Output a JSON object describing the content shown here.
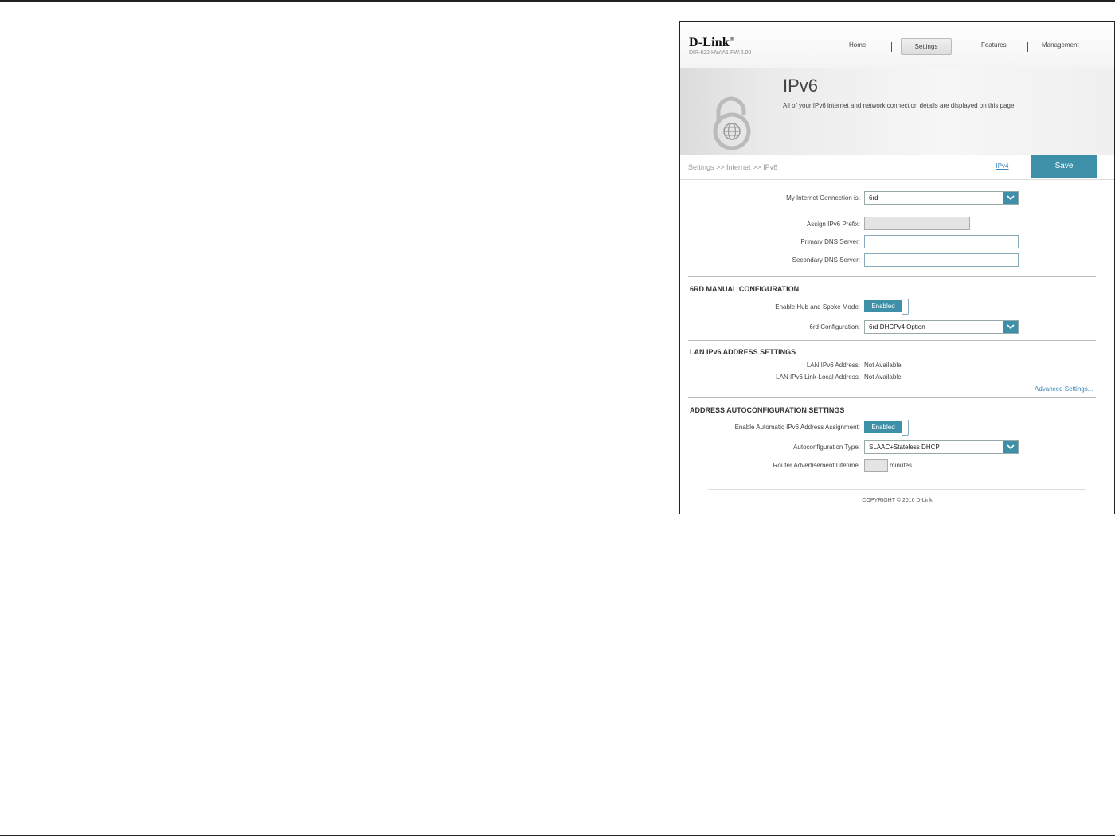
{
  "brand": {
    "logo": "D-Link",
    "model_info": "DIR-822 HW:A1 FW:2.00"
  },
  "nav": {
    "home": "Home",
    "settings": "Settings",
    "features": "Features",
    "management": "Management"
  },
  "banner": {
    "title": "IPv6",
    "description": "All of your IPv6 internet and network connection details are displayed on this page.",
    "icon": "lock-globe-icon"
  },
  "breadcrumb": "Settings >> Internet >> IPv6",
  "actions": {
    "ipv4": "IPv4",
    "save": "Save"
  },
  "connection": {
    "label": "My Internet Connection is:",
    "value": "6rd",
    "assign_prefix_label": "Assign IPv6 Prefix:",
    "assign_prefix_value": "",
    "primary_dns_label": "Primary DNS Server:",
    "primary_dns_value": "",
    "secondary_dns_label": "Secondary DNS Server:",
    "secondary_dns_value": ""
  },
  "sixrd": {
    "heading": "6RD MANUAL CONFIGURATION",
    "hub_spoke_label": "Enable Hub and Spoke Mode:",
    "hub_spoke_state": "Enabled",
    "config_label": "6rd Configuration:",
    "config_value": "6rd DHCPv4 Option"
  },
  "lan": {
    "heading": "LAN IPv6 ADDRESS SETTINGS",
    "address_label": "LAN IPv6 Address:",
    "address_value": "Not Available",
    "link_local_label": "LAN IPv6 Link-Local Address:",
    "link_local_value": "Not Available",
    "advanced": "Advanced Settings..."
  },
  "autoconfig": {
    "heading": "ADDRESS AUTOCONFIGURATION SETTINGS",
    "auto_assign_label": "Enable Automatic IPv6 Address Assignment:",
    "auto_assign_state": "Enabled",
    "type_label": "Autoconfiguration Type:",
    "type_value": "SLAAC+Stateless DHCP",
    "lifetime_label": "Router Advertisement Lifetime:",
    "lifetime_value": "",
    "lifetime_unit": "minutes"
  },
  "footer": {
    "copyright": "COPYRIGHT © 2016 D-Link"
  },
  "colors": {
    "accent": "#3e90a8",
    "link": "#3a86b8"
  }
}
